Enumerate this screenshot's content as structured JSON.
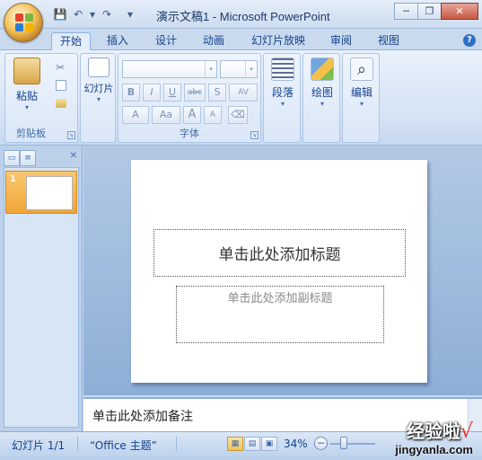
{
  "window": {
    "title": "演示文稿1 - Microsoft PowerPoint",
    "quick_access": {
      "save": "💾",
      "undo": "↶",
      "redo": "↷",
      "customize": "▾"
    },
    "controls": {
      "minimize": "─",
      "restore": "❐",
      "close": "✕"
    }
  },
  "tabs": [
    "开始",
    "插入",
    "设计",
    "动画",
    "幻灯片放映",
    "审阅",
    "视图"
  ],
  "active_tab": "开始",
  "help_label": "?",
  "ribbon": {
    "clipboard": {
      "label": "剪贴板",
      "paste": "粘贴",
      "launcher": "↘"
    },
    "slides": {
      "new_slide": "幻灯片"
    },
    "font": {
      "label": "字体",
      "launcher": "↘",
      "bold": "B",
      "italic": "I",
      "underline": "U",
      "strike": "abc",
      "shadow": "S",
      "spacing": "AV",
      "grow": "A",
      "shrink": "Aa",
      "size_up": "A",
      "size_down": "A"
    },
    "paragraph": {
      "label": "段落"
    },
    "drawing": {
      "label": "绘图"
    },
    "editing": {
      "label": "编辑"
    },
    "dropdown_arrow": "▾"
  },
  "left_pane": {
    "close": "✕",
    "slides": [
      {
        "number": "1"
      }
    ]
  },
  "slide": {
    "title_placeholder": "单击此处添加标题",
    "subtitle_placeholder": "单击此处添加副标题"
  },
  "notes": {
    "placeholder": "单击此处添加备注"
  },
  "status": {
    "slide_counter": "幻灯片 1/1",
    "theme": "“Office 主题”",
    "zoom": "34%",
    "zoom_out": "−"
  },
  "watermark": {
    "main": "经验啦",
    "check": "√",
    "sub": "jingyanla.com"
  },
  "colors": {
    "accent": "#15428b",
    "ribbon": "#dae7f7",
    "selection": "#f0a537"
  }
}
